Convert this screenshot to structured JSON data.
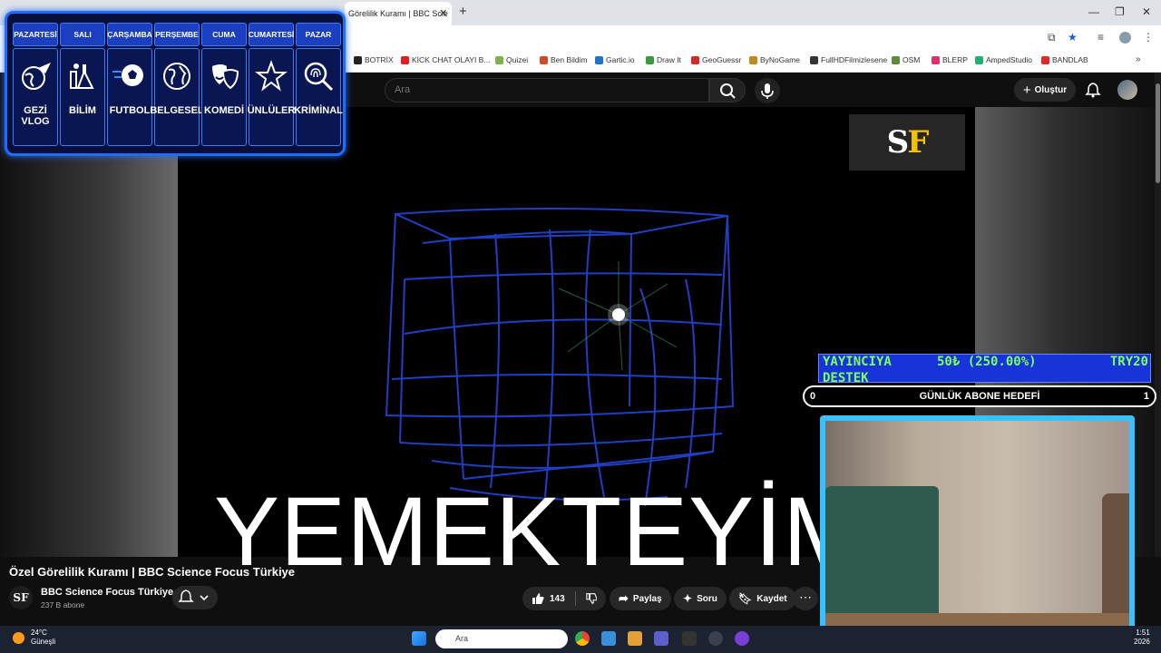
{
  "browser": {
    "tab_title": "Görelilik Kuramı | BBC Scie",
    "bookmarks": [
      {
        "label": "BOTRİX",
        "color": "#222222"
      },
      {
        "label": "KİCK CHAT OLAYI B...",
        "color": "#e02020"
      },
      {
        "label": "Quizei",
        "color": "#7fb34a"
      },
      {
        "label": "Ben Bildim",
        "color": "#d04a2a"
      },
      {
        "label": "Gartic.io",
        "color": "#1f73c8"
      },
      {
        "label": "Draw It",
        "color": "#3a9a3a"
      },
      {
        "label": "GeoGuessr",
        "color": "#d02a2a"
      },
      {
        "label": "ByNoGame",
        "color": "#c08a20"
      },
      {
        "label": "FullHDFilmizlesene",
        "color": "#333333"
      },
      {
        "label": "OSM",
        "color": "#5a8a3a"
      },
      {
        "label": "BLERP",
        "color": "#e0306a"
      },
      {
        "label": "AmpedStudio",
        "color": "#20b070"
      },
      {
        "label": "BANDLAB",
        "color": "#e02a2a"
      }
    ]
  },
  "youtube": {
    "search_placeholder": "Ara",
    "create_label": "Oluştur",
    "video_title": "Özel Görelilik Kuramı | BBC Science Focus Türkiye",
    "channel_name": "BBC Science Focus Türkiye",
    "channel_subs": "237 B abone",
    "channel_logo": "SF",
    "like_count": "143",
    "share_label": "Paylaş",
    "ask_label": "Soru",
    "save_label": "Kaydet"
  },
  "schedule": [
    {
      "day": "PAZARTESİ",
      "label": "GEZİ VLOG",
      "icon": "globe-plane-icon"
    },
    {
      "day": "SALI",
      "label": "BİLİM",
      "icon": "lab-icon"
    },
    {
      "day": "ÇARŞAMBA",
      "label": "FUTBOL",
      "icon": "soccer-ball-icon"
    },
    {
      "day": "PERŞEMBE",
      "label": "BELGESEL",
      "icon": "earth-icon"
    },
    {
      "day": "CUMA",
      "label": "KOMEDİ",
      "icon": "comedy-mask-icon"
    },
    {
      "day": "CUMARTESİ",
      "label": "ÜNLÜLER",
      "icon": "star-icon"
    },
    {
      "day": "PAZAR",
      "label": "KRİMİNAL",
      "icon": "fingerprint-icon"
    }
  ],
  "overlay": {
    "big_text": "YEMEKTEYİM",
    "donation_label_1": "YAYINCIYA",
    "donation_label_2": "DESTEK",
    "donation_amount": "50₺ (250.00%)",
    "donation_currency": "TRY20",
    "goal_label": "GÜNLÜK ABONE HEDEFİ",
    "goal_current": "0",
    "goal_target": "1"
  },
  "taskbar": {
    "weather_temp": "24°C",
    "weather_desc": "Güneşli",
    "search_label": "Ara",
    "time": "1:51",
    "date": "2026"
  },
  "colors": {
    "schedule_border": "#1e6dff",
    "donation_bg": "#1634d8",
    "donation_text": "#7dff5a",
    "webcam_frame": "#38c0ff"
  }
}
